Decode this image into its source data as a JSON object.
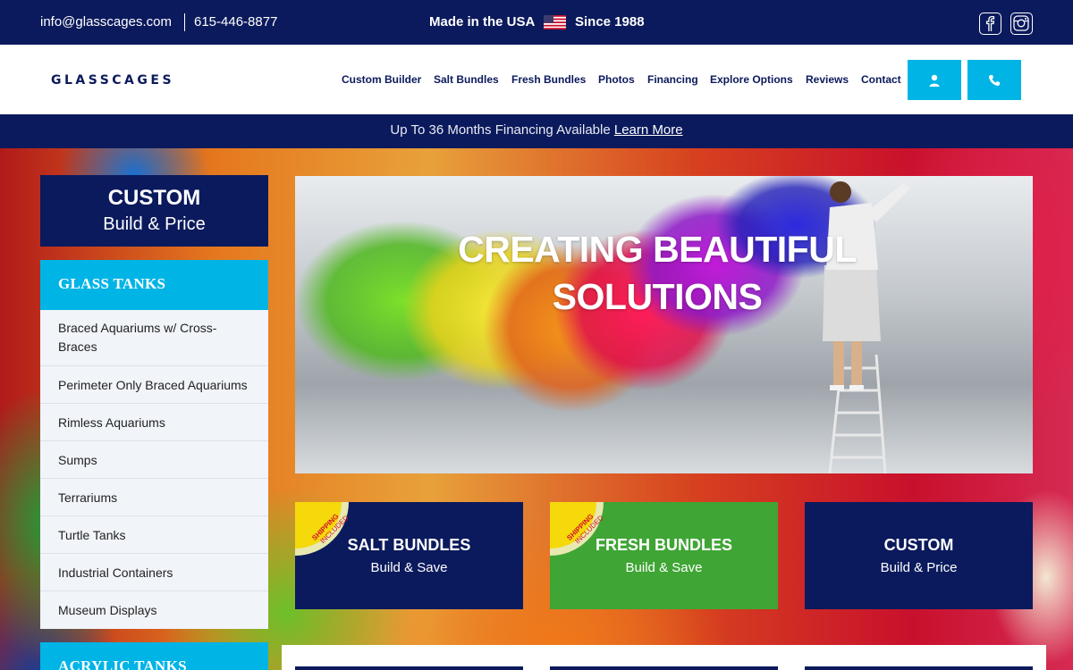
{
  "topbar": {
    "email": "info@glasscages.com",
    "phone": "615-446-8877",
    "made_in": "Made in the USA",
    "since": "Since 1988",
    "bg_color": "#0b1a5c"
  },
  "header": {
    "logo": "GLASSCAGES",
    "nav": [
      "Custom Builder",
      "Salt Bundles",
      "Fresh Bundles",
      "Photos",
      "Financing",
      "Explore Options",
      "Reviews",
      "Contact"
    ],
    "accent_color": "#00b4e6"
  },
  "financing_banner": {
    "text": "Up To 36 Months Financing Available",
    "link": "Learn More"
  },
  "sidebar": {
    "custom_title": "CUSTOM",
    "custom_subtitle": "Build & Price",
    "glass_heading": "GLASS TANKS",
    "glass_items": [
      "Braced Aquariums w/ Cross-Braces",
      "Perimeter Only Braced Aquariums",
      "Rimless Aquariums",
      "Sumps",
      "Terrariums",
      "Turtle Tanks",
      "Industrial Containers",
      "Museum Displays"
    ],
    "acrylic_heading": "ACRYLIC TANKS"
  },
  "hero": {
    "title_line1": "CREATING BEAUTIFUL",
    "title_line2": "SOLUTIONS"
  },
  "promos": [
    {
      "title": "SALT BUNDLES",
      "subtitle": "Build & Save",
      "ribbon_line1": "SHIPPING",
      "ribbon_line2": "INCLUDED",
      "color": "#0b1a5c"
    },
    {
      "title": "FRESH BUNDLES",
      "subtitle": "Build & Save",
      "ribbon_line1": "SHIPPING",
      "ribbon_line2": "INCLUDED",
      "color": "#3fa535"
    },
    {
      "title": "CUSTOM",
      "subtitle": "Build & Price",
      "color": "#0b1a5c"
    }
  ]
}
